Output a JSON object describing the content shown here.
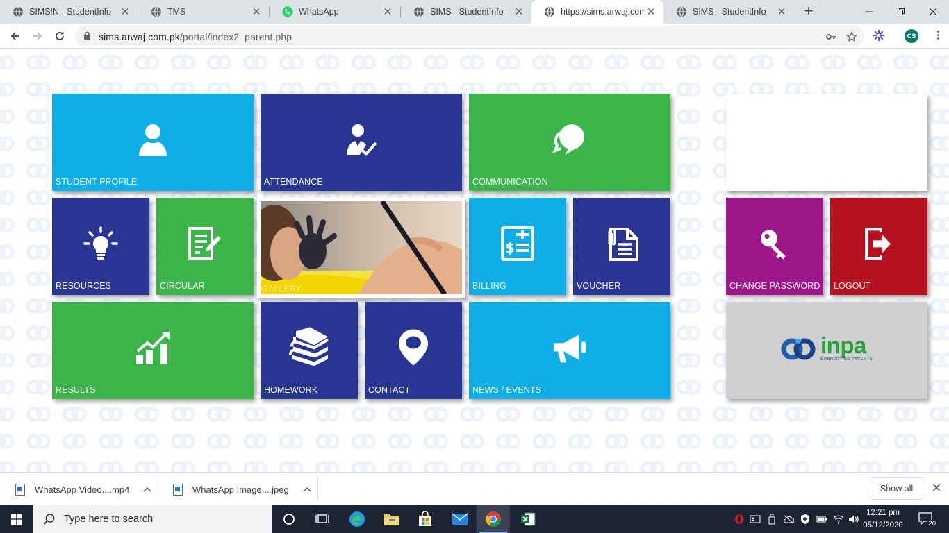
{
  "browser": {
    "tabs": [
      {
        "title": "SIMS!N - StudentInfo",
        "favicon": "globe-icon",
        "active": false
      },
      {
        "title": "TMS",
        "favicon": "globe-icon",
        "active": false
      },
      {
        "title": "WhatsApp",
        "favicon": "whatsapp-icon",
        "active": false
      },
      {
        "title": "SIMS - StudentInfo",
        "favicon": "globe-icon",
        "active": false
      },
      {
        "title": "https://sims.arwaj.com.p",
        "favicon": "globe-icon",
        "active": true
      },
      {
        "title": "SIMS - StudentInfo",
        "favicon": "globe-icon",
        "active": false
      }
    ],
    "new_tab_label": "+",
    "url_host": "sims.arwaj.com.pk",
    "url_path": "/portal/index2_parent.php",
    "profile_initials": "CS"
  },
  "tiles": {
    "student_profile": "STUDENT PROFILE",
    "attendance": "ATTENDANCE",
    "communication": "COMMUNICATION",
    "resources": "RESOURCES",
    "circular": "CIRCULAR",
    "gallery": "GALLERY",
    "billing": "BILLING",
    "voucher": "VOUCHER",
    "change_password": "CHANGE PASSWORD",
    "logout": "LOGOUT",
    "results": "RESULTS",
    "homework": "HOMEWORK",
    "contact": "CONTACT",
    "news_events": "NEWS / EVENTS"
  },
  "brand": {
    "logo_text": "inpa",
    "tagline": "CONNECTING PARENTS"
  },
  "colors": {
    "sky_blue": "#0eaee9",
    "navy": "#283593",
    "green": "#3bb54a",
    "magenta": "#9c1589",
    "crimson": "#b5111e",
    "logo_grey": "#cfcfcf"
  },
  "downloads": {
    "items": [
      {
        "name": "WhatsApp Video....mp4"
      },
      {
        "name": "WhatsApp Image....jpeg"
      }
    ],
    "show_all": "Show all"
  },
  "taskbar": {
    "search_placeholder": "Type here to search",
    "time": "12:21 pm",
    "date": "05/12/2020",
    "notification_count": "20"
  }
}
